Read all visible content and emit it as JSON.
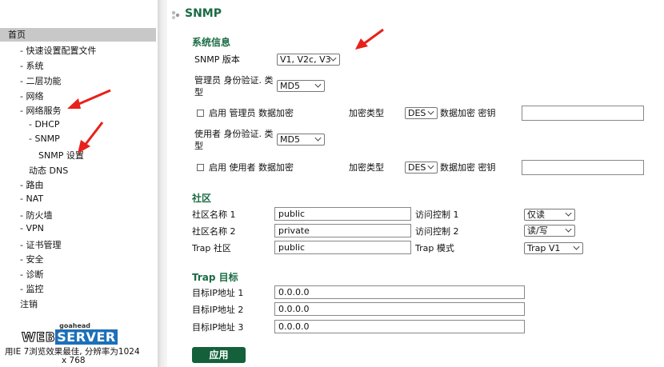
{
  "sidebar": {
    "home": "首页",
    "items": [
      {
        "label": "- 快速设置配置文件"
      },
      {
        "label": "- 系统"
      },
      {
        "label": "- 二层功能"
      },
      {
        "label": "- 网络"
      },
      {
        "label": "- 网络服务"
      },
      {
        "label": "- DHCP"
      },
      {
        "label": "- SNMP"
      },
      {
        "label": "SNMP 设置"
      },
      {
        "label": "动态 DNS"
      },
      {
        "label": "- 路由"
      },
      {
        "label": "- NAT"
      },
      {
        "label": "- 防火墙"
      },
      {
        "label": "- VPN"
      },
      {
        "label": "- 证书管理"
      },
      {
        "label": "- 安全"
      },
      {
        "label": "- 诊断"
      },
      {
        "label": "- 监控"
      },
      {
        "label": "注销"
      }
    ],
    "logo": {
      "top": "goahead",
      "web": "WEB",
      "server": "SERVER"
    },
    "footer_line1": "用IE 7浏览效果最佳, 分辨率为1024",
    "footer_line2": "x 768"
  },
  "page": {
    "title": "SNMP",
    "system_info": {
      "heading": "系统信息",
      "version_label": "SNMP 版本",
      "version_value": "V1, V2c, V3",
      "admin_auth_label_1": "管理员 身份验证. 类",
      "admin_auth_label_2": "型",
      "admin_auth_value": "MD5",
      "admin_encrypt_label": "启用 管理员 数据加密",
      "admin_encrypt_type_label": "加密类型",
      "admin_encrypt_type_value": "DES",
      "admin_key_label": "数据加密 密钥",
      "admin_key_value": "",
      "user_auth_label_1": "使用者 身份验证. 类",
      "user_auth_label_2": "型",
      "user_auth_value": "MD5",
      "user_encrypt_label": "启用 使用者 数据加密",
      "user_encrypt_type_label": "加密类型",
      "user_encrypt_type_value": "DES",
      "user_key_label": "数据加密 密钥",
      "user_key_value": ""
    },
    "community": {
      "heading": "社区",
      "name1_label": "社区名称 1",
      "name1_value": "public",
      "access1_label": "访问控制 1",
      "access1_value": "仅读",
      "name2_label": "社区名称 2",
      "name2_value": "private",
      "access2_label": "访问控制 2",
      "access2_value": "读/写",
      "trap_label": "Trap 社区",
      "trap_value": "public",
      "trap_mode_label": "Trap 模式",
      "trap_mode_value": "Trap V1"
    },
    "trap_target": {
      "heading": "Trap 目标",
      "ip1_label": "目标IP地址 1",
      "ip1_value": "0.0.0.0",
      "ip2_label": "目标IP地址 2",
      "ip2_value": "0.0.0.0",
      "ip3_label": "目标IP地址 3",
      "ip3_value": "0.0.0.0"
    },
    "apply_label": "应用"
  },
  "colors": {
    "accent": "#1a6b44",
    "annotation": "#e8211a"
  }
}
